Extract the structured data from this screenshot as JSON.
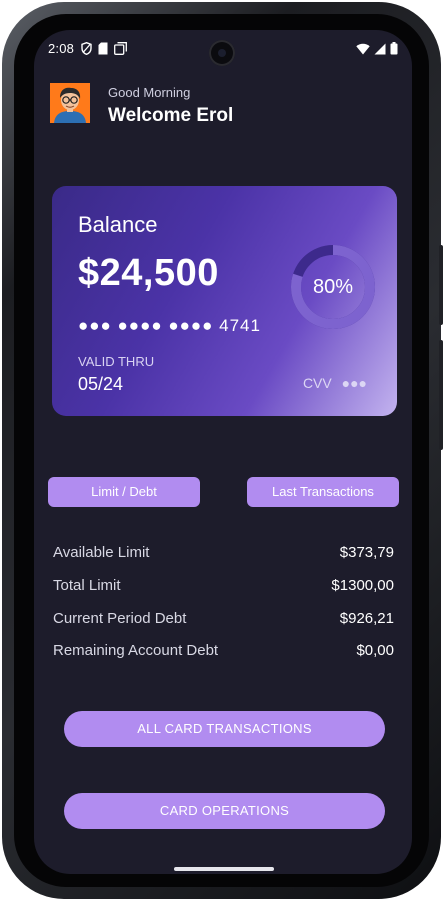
{
  "status_bar": {
    "time": "2:08"
  },
  "header": {
    "greeting": "Good Morning",
    "welcome": "Welcome Erol"
  },
  "card": {
    "balance_label": "Balance",
    "balance_amount": "$24,500",
    "masked_number": "●●● ●●●● ●●●● 4741",
    "valid_label": "VALID THRU",
    "valid_value": "05/24",
    "cvv_label": "CVV",
    "cvv_masked": "●●●",
    "usage_percent_text": "80%",
    "usage_fraction": 0.8
  },
  "tabs": {
    "limit_debt": "Limit / Debt",
    "last_transactions": "Last Transactions"
  },
  "details": [
    {
      "label": "Available Limit",
      "value": "$373,79"
    },
    {
      "label": "Total Limit",
      "value": "$1300,00"
    },
    {
      "label": "Current Period Debt",
      "value": "$926,21"
    },
    {
      "label": "Remaining Account Debt",
      "value": "$0,00"
    }
  ],
  "actions": {
    "all_transactions": "ALL CARD TRANSACTIONS",
    "card_operations": "CARD OPERATIONS"
  },
  "colors": {
    "background": "#1d1c2b",
    "accent": "#b18cf0",
    "card_start": "#3a2a88",
    "card_end": "#c3b3ef"
  }
}
